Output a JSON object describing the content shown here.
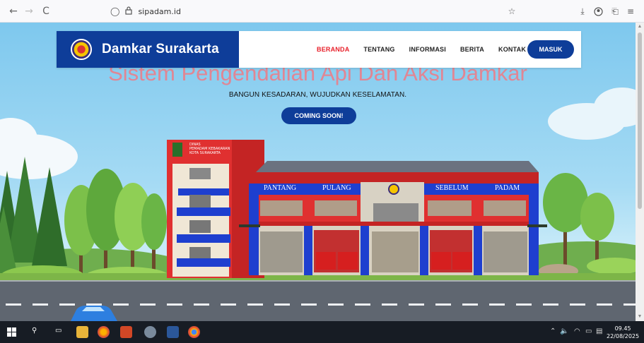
{
  "browser": {
    "url": "sipadam.id",
    "back_icon": "←",
    "forward_icon": "→",
    "reload_icon": "C",
    "shield_icon": "◯",
    "lock_icon": "🔒"
  },
  "site": {
    "brand_name": "Damkar Surakarta",
    "menu": [
      {
        "label": "BERANDA",
        "active": true
      },
      {
        "label": "TENTANG",
        "active": false
      },
      {
        "label": "INFORMASI",
        "active": false
      },
      {
        "label": "BERITA",
        "active": false
      },
      {
        "label": "KONTAK",
        "active": false
      }
    ],
    "login_label": "MASUK"
  },
  "hero": {
    "title": "Sistem Pengendalian Api Dan Aksi Damkar",
    "subtitle": "BANGUN KESADARAN, WUJUDKAN KESELAMATAN.",
    "cta_label": "COMING SOON!"
  },
  "building": {
    "sign_line1": "DINAS",
    "sign_line2": "PEMADAM KEBAKARAN",
    "sign_line3": "KOTA SURAKARTA",
    "banner_words": [
      "PANTANG",
      "PULANG",
      "SEBELUM",
      "PADAM"
    ]
  },
  "taskbar": {
    "time": "09.45",
    "date": "22/08/2025"
  },
  "colors": {
    "brand_blue": "#0e3d99",
    "active_red": "#e8202a",
    "hero_title": "#f07a84"
  }
}
